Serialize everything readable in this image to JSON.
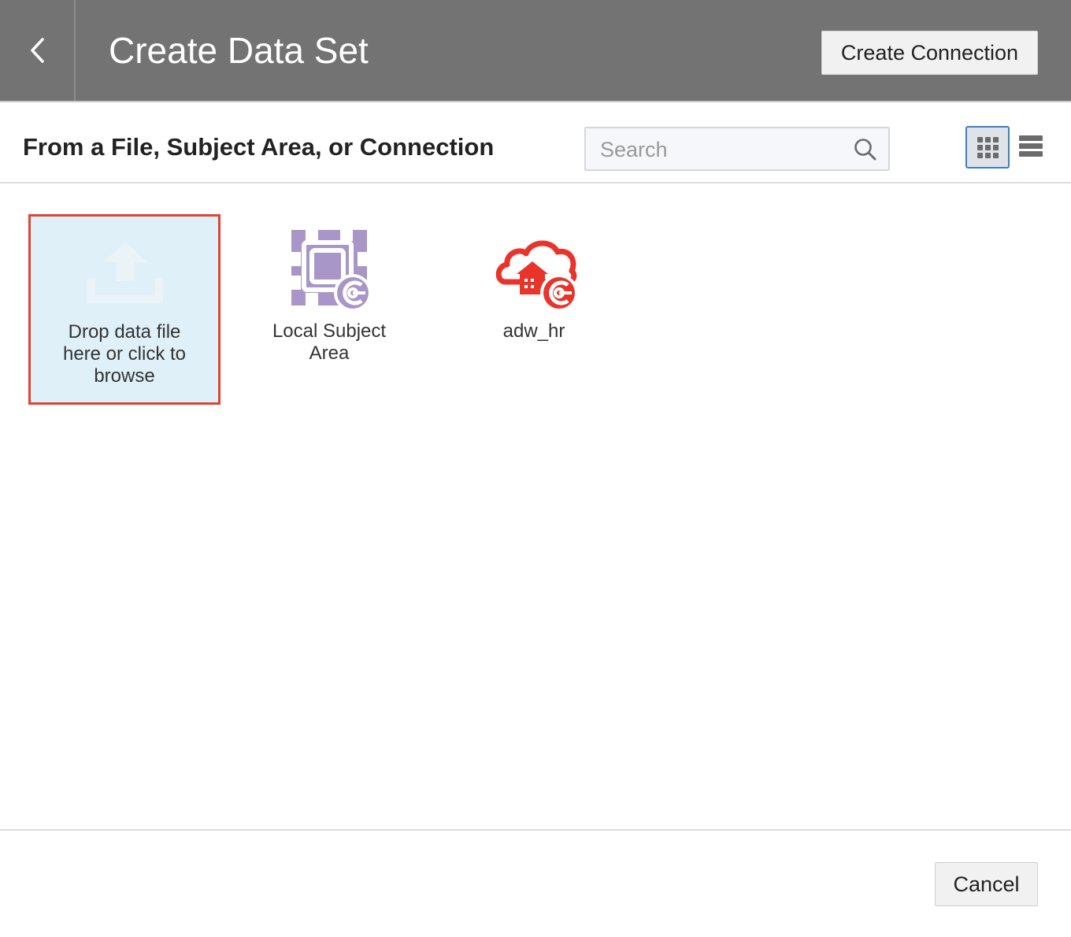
{
  "header": {
    "title": "Create Data Set",
    "create_connection_label": "Create Connection",
    "back_icon": "chevron-left-icon"
  },
  "toolbar": {
    "title": "From a File, Subject Area, or Connection",
    "search_placeholder": "Search",
    "search_value": "",
    "views": [
      "grid-view",
      "list-view"
    ],
    "active_view": "grid-view"
  },
  "tiles": [
    {
      "label": "Drop data file\nhere or click to\nbrowse",
      "icon": "upload-icon",
      "selected": true
    },
    {
      "label": "Local Subject\nArea",
      "icon": "subject-area-icon",
      "selected": false
    },
    {
      "label": "adw_hr",
      "icon": "cloud-database-connection-icon",
      "selected": false
    }
  ],
  "footer": {
    "cancel_label": "Cancel"
  },
  "colors": {
    "header_bg": "#737373",
    "selection_border": "#e2432e",
    "selection_bg": "#dff0f8",
    "subject_area_purple": "#a996c9",
    "connection_red": "#e8342a",
    "active_view_border": "#3d7fc4"
  }
}
